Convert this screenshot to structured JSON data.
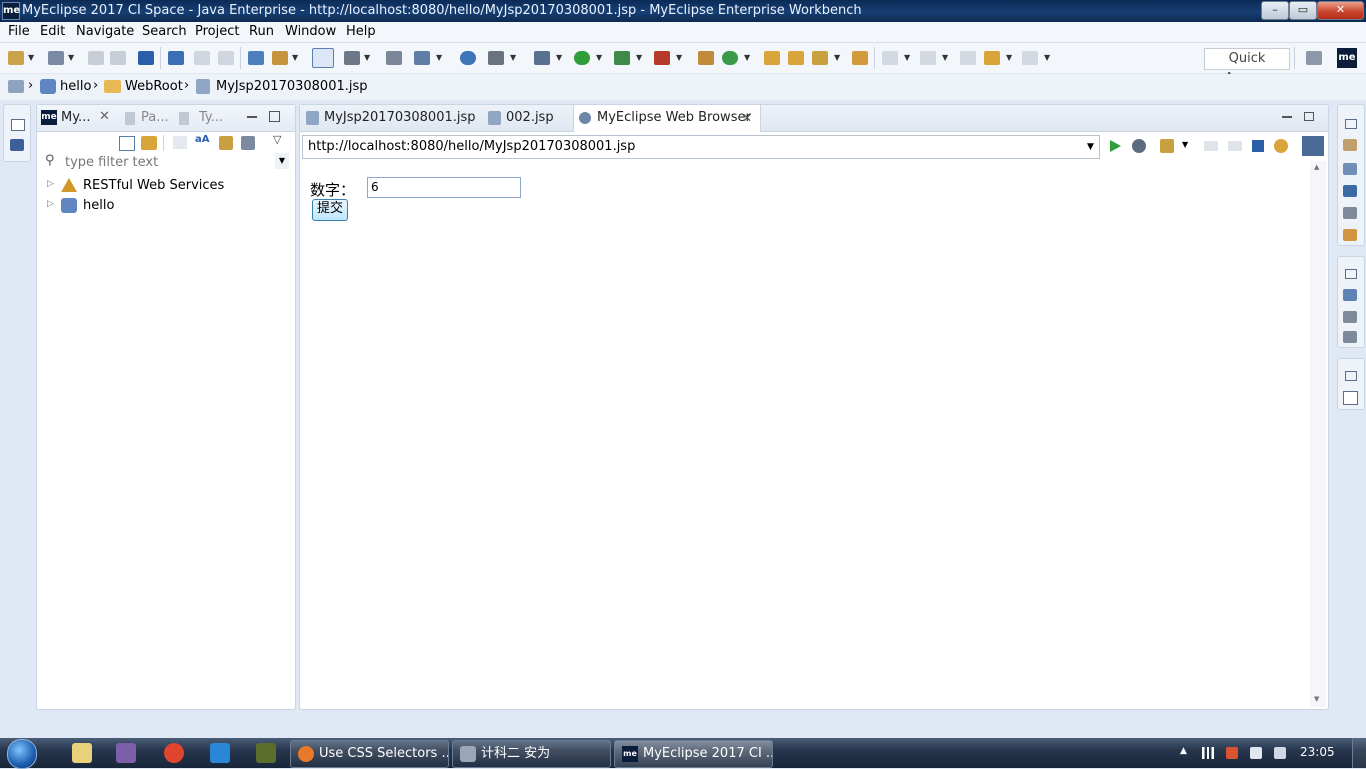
{
  "window": {
    "title": "MyEclipse 2017 CI Space - Java Enterprise - http://localhost:8080/hello/MyJsp20170308001.jsp - MyEclipse Enterprise Workbench",
    "logo": "me",
    "minimize": "–",
    "maximize": "▭",
    "close": "✕"
  },
  "menu": [
    "File",
    "Edit",
    "Navigate",
    "Search",
    "Project",
    "Run",
    "Window",
    "Help"
  ],
  "toolbar": {
    "quick_access": "Quick Access",
    "perspective_logo": "me"
  },
  "breadcrumb": {
    "project": "hello",
    "folder": "WebRoot",
    "file": "MyJsp20170308001.jsp"
  },
  "left_panel": {
    "tabs": [
      "My...",
      "Pa...",
      "Ty..."
    ],
    "filter_placeholder": "type filter text",
    "tree": [
      "RESTful Web Services",
      "hello"
    ]
  },
  "editor": {
    "tabs": [
      "MyJsp20170308001.jsp",
      "002.jsp",
      "MyEclipse Web Browser"
    ],
    "active_tab": 2,
    "url": "http://localhost:8080/hello/MyJsp20170308001.jsp"
  },
  "page": {
    "label": "数字：",
    "input_value": "6",
    "submit_label": "提交"
  },
  "taskbar": {
    "items": [
      "Use CSS Selectors ...",
      "计科二  安为",
      "MyEclipse 2017 CI ..."
    ],
    "active_item": 2,
    "clock": "23:05"
  },
  "colors": {
    "title_bar": "#173f73",
    "accent_blue": "#2a5ea8",
    "taskbar": "#27364d",
    "run_green": "#2e9d3a"
  }
}
